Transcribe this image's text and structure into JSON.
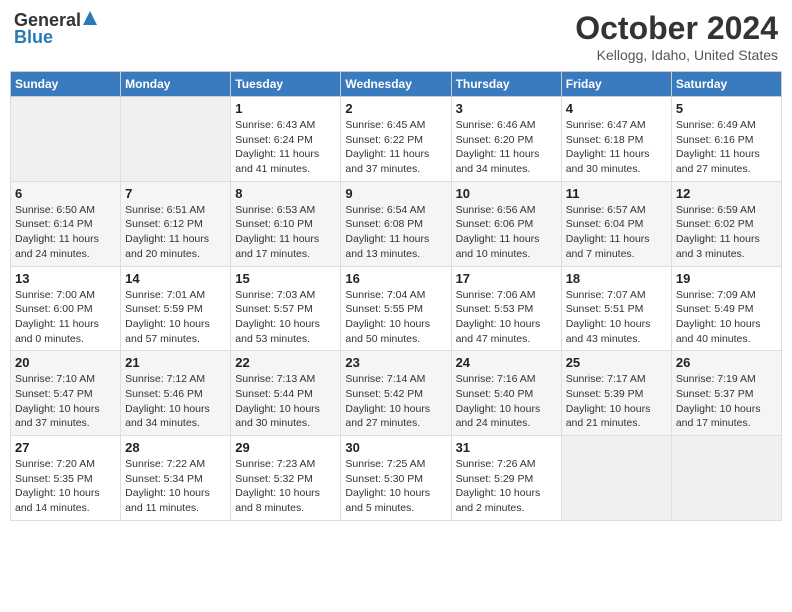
{
  "header": {
    "logo_general": "General",
    "logo_blue": "Blue",
    "month_title": "October 2024",
    "location": "Kellogg, Idaho, United States"
  },
  "days_of_week": [
    "Sunday",
    "Monday",
    "Tuesday",
    "Wednesday",
    "Thursday",
    "Friday",
    "Saturday"
  ],
  "weeks": [
    [
      {
        "day": "",
        "empty": true
      },
      {
        "day": "",
        "empty": true
      },
      {
        "day": "1",
        "sunrise": "Sunrise: 6:43 AM",
        "sunset": "Sunset: 6:24 PM",
        "daylight": "Daylight: 11 hours and 41 minutes."
      },
      {
        "day": "2",
        "sunrise": "Sunrise: 6:45 AM",
        "sunset": "Sunset: 6:22 PM",
        "daylight": "Daylight: 11 hours and 37 minutes."
      },
      {
        "day": "3",
        "sunrise": "Sunrise: 6:46 AM",
        "sunset": "Sunset: 6:20 PM",
        "daylight": "Daylight: 11 hours and 34 minutes."
      },
      {
        "day": "4",
        "sunrise": "Sunrise: 6:47 AM",
        "sunset": "Sunset: 6:18 PM",
        "daylight": "Daylight: 11 hours and 30 minutes."
      },
      {
        "day": "5",
        "sunrise": "Sunrise: 6:49 AM",
        "sunset": "Sunset: 6:16 PM",
        "daylight": "Daylight: 11 hours and 27 minutes."
      }
    ],
    [
      {
        "day": "6",
        "sunrise": "Sunrise: 6:50 AM",
        "sunset": "Sunset: 6:14 PM",
        "daylight": "Daylight: 11 hours and 24 minutes."
      },
      {
        "day": "7",
        "sunrise": "Sunrise: 6:51 AM",
        "sunset": "Sunset: 6:12 PM",
        "daylight": "Daylight: 11 hours and 20 minutes."
      },
      {
        "day": "8",
        "sunrise": "Sunrise: 6:53 AM",
        "sunset": "Sunset: 6:10 PM",
        "daylight": "Daylight: 11 hours and 17 minutes."
      },
      {
        "day": "9",
        "sunrise": "Sunrise: 6:54 AM",
        "sunset": "Sunset: 6:08 PM",
        "daylight": "Daylight: 11 hours and 13 minutes."
      },
      {
        "day": "10",
        "sunrise": "Sunrise: 6:56 AM",
        "sunset": "Sunset: 6:06 PM",
        "daylight": "Daylight: 11 hours and 10 minutes."
      },
      {
        "day": "11",
        "sunrise": "Sunrise: 6:57 AM",
        "sunset": "Sunset: 6:04 PM",
        "daylight": "Daylight: 11 hours and 7 minutes."
      },
      {
        "day": "12",
        "sunrise": "Sunrise: 6:59 AM",
        "sunset": "Sunset: 6:02 PM",
        "daylight": "Daylight: 11 hours and 3 minutes."
      }
    ],
    [
      {
        "day": "13",
        "sunrise": "Sunrise: 7:00 AM",
        "sunset": "Sunset: 6:00 PM",
        "daylight": "Daylight: 11 hours and 0 minutes."
      },
      {
        "day": "14",
        "sunrise": "Sunrise: 7:01 AM",
        "sunset": "Sunset: 5:59 PM",
        "daylight": "Daylight: 10 hours and 57 minutes."
      },
      {
        "day": "15",
        "sunrise": "Sunrise: 7:03 AM",
        "sunset": "Sunset: 5:57 PM",
        "daylight": "Daylight: 10 hours and 53 minutes."
      },
      {
        "day": "16",
        "sunrise": "Sunrise: 7:04 AM",
        "sunset": "Sunset: 5:55 PM",
        "daylight": "Daylight: 10 hours and 50 minutes."
      },
      {
        "day": "17",
        "sunrise": "Sunrise: 7:06 AM",
        "sunset": "Sunset: 5:53 PM",
        "daylight": "Daylight: 10 hours and 47 minutes."
      },
      {
        "day": "18",
        "sunrise": "Sunrise: 7:07 AM",
        "sunset": "Sunset: 5:51 PM",
        "daylight": "Daylight: 10 hours and 43 minutes."
      },
      {
        "day": "19",
        "sunrise": "Sunrise: 7:09 AM",
        "sunset": "Sunset: 5:49 PM",
        "daylight": "Daylight: 10 hours and 40 minutes."
      }
    ],
    [
      {
        "day": "20",
        "sunrise": "Sunrise: 7:10 AM",
        "sunset": "Sunset: 5:47 PM",
        "daylight": "Daylight: 10 hours and 37 minutes."
      },
      {
        "day": "21",
        "sunrise": "Sunrise: 7:12 AM",
        "sunset": "Sunset: 5:46 PM",
        "daylight": "Daylight: 10 hours and 34 minutes."
      },
      {
        "day": "22",
        "sunrise": "Sunrise: 7:13 AM",
        "sunset": "Sunset: 5:44 PM",
        "daylight": "Daylight: 10 hours and 30 minutes."
      },
      {
        "day": "23",
        "sunrise": "Sunrise: 7:14 AM",
        "sunset": "Sunset: 5:42 PM",
        "daylight": "Daylight: 10 hours and 27 minutes."
      },
      {
        "day": "24",
        "sunrise": "Sunrise: 7:16 AM",
        "sunset": "Sunset: 5:40 PM",
        "daylight": "Daylight: 10 hours and 24 minutes."
      },
      {
        "day": "25",
        "sunrise": "Sunrise: 7:17 AM",
        "sunset": "Sunset: 5:39 PM",
        "daylight": "Daylight: 10 hours and 21 minutes."
      },
      {
        "day": "26",
        "sunrise": "Sunrise: 7:19 AM",
        "sunset": "Sunset: 5:37 PM",
        "daylight": "Daylight: 10 hours and 17 minutes."
      }
    ],
    [
      {
        "day": "27",
        "sunrise": "Sunrise: 7:20 AM",
        "sunset": "Sunset: 5:35 PM",
        "daylight": "Daylight: 10 hours and 14 minutes."
      },
      {
        "day": "28",
        "sunrise": "Sunrise: 7:22 AM",
        "sunset": "Sunset: 5:34 PM",
        "daylight": "Daylight: 10 hours and 11 minutes."
      },
      {
        "day": "29",
        "sunrise": "Sunrise: 7:23 AM",
        "sunset": "Sunset: 5:32 PM",
        "daylight": "Daylight: 10 hours and 8 minutes."
      },
      {
        "day": "30",
        "sunrise": "Sunrise: 7:25 AM",
        "sunset": "Sunset: 5:30 PM",
        "daylight": "Daylight: 10 hours and 5 minutes."
      },
      {
        "day": "31",
        "sunrise": "Sunrise: 7:26 AM",
        "sunset": "Sunset: 5:29 PM",
        "daylight": "Daylight: 10 hours and 2 minutes."
      },
      {
        "day": "",
        "empty": true
      },
      {
        "day": "",
        "empty": true
      }
    ]
  ]
}
